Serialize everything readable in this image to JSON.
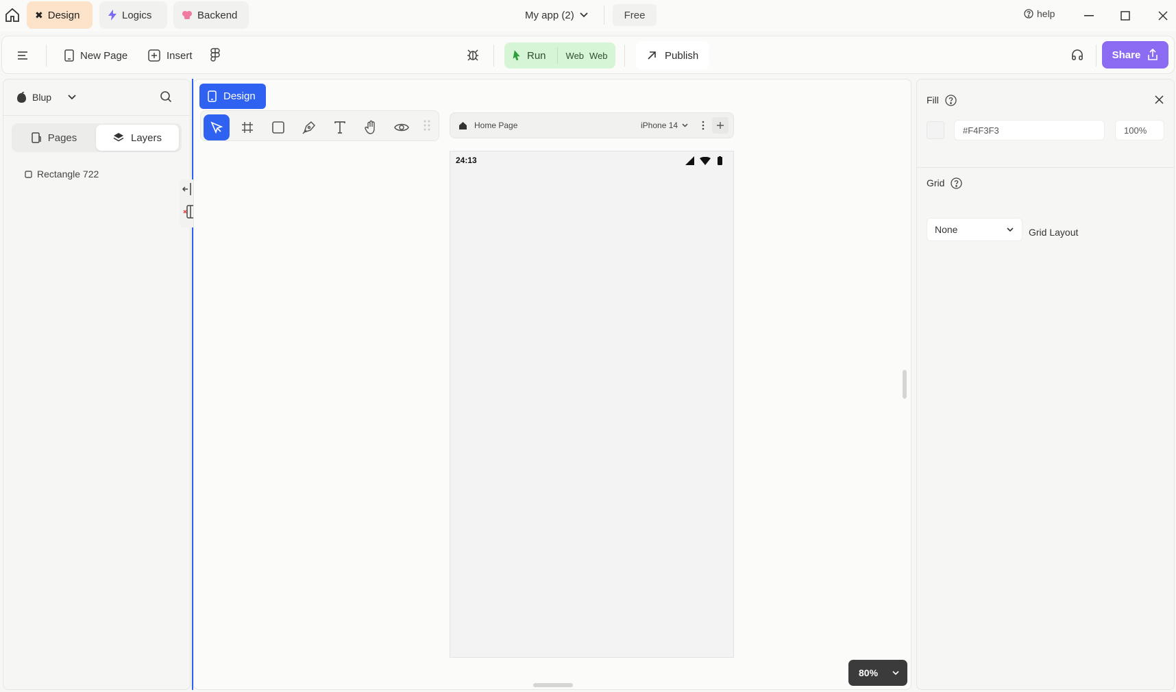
{
  "topbar": {
    "tabs": [
      {
        "label": "Design",
        "icon": "design-tools-icon"
      },
      {
        "label": "Logics",
        "icon": "lightning-icon"
      },
      {
        "label": "Backend",
        "icon": "brain-icon"
      }
    ],
    "app_name": "My app (2)",
    "plan_badge": "Free",
    "help_label": "help"
  },
  "toolbar": {
    "new_page_label": "New Page",
    "insert_label": "Insert",
    "run_label": "Run",
    "run_target_1": "Web",
    "run_target_2": "Web",
    "publish_label": "Publish",
    "share_label": "Share"
  },
  "left_panel": {
    "project_name": "Blup",
    "tabs": {
      "pages": "Pages",
      "layers": "Layers"
    },
    "layers": [
      "Rectangle 722"
    ]
  },
  "canvas": {
    "mode_label": "Design",
    "page_bar": {
      "page_name": "Home Page",
      "device": "iPhone 14"
    },
    "status_time": "24:13",
    "zoom": "80%"
  },
  "right_panel": {
    "fill_label": "Fill",
    "fill_hex": "#F4F3F3",
    "fill_opacity": "100%",
    "grid_label": "Grid",
    "grid_select_value": "None",
    "grid_layout_label": "Grid Layout"
  },
  "colors": {
    "accent": "#2f62f1",
    "share_purple": "#8b6bf2",
    "run_green": "#d6f5d6",
    "design_tab": "#fbe2c8",
    "phone_fill": "#F4F3F3"
  }
}
